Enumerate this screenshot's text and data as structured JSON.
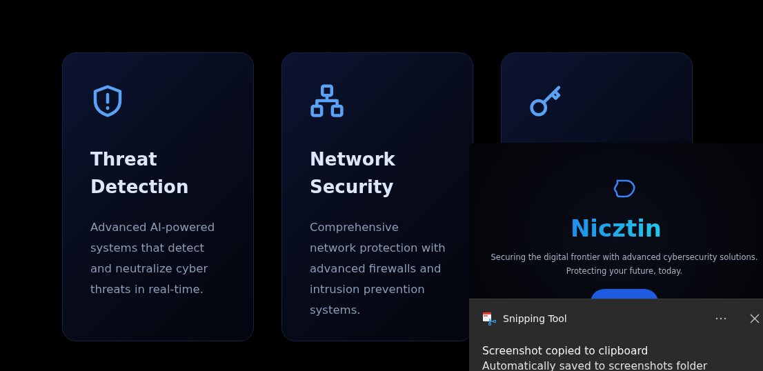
{
  "cards": [
    {
      "kind": "shield",
      "title": "Threat Detection",
      "description": "Advanced AI-powered systems that detect and neutralize cyber threats in real-time."
    },
    {
      "kind": "network",
      "title": "Network Security",
      "description": "Comprehensive network protection with advanced firewalls and intrusion prevention systems."
    },
    {
      "kind": "key"
    }
  ],
  "overlay": {
    "brand": "Nicztin",
    "tagline": "Securing the digital frontier with advanced cybersecurity solutions. Protecting your future, today."
  },
  "notification": {
    "app": "Snipping Tool",
    "title": "Screenshot copied to clipboard",
    "body": "Automatically saved to screenshots folder"
  }
}
